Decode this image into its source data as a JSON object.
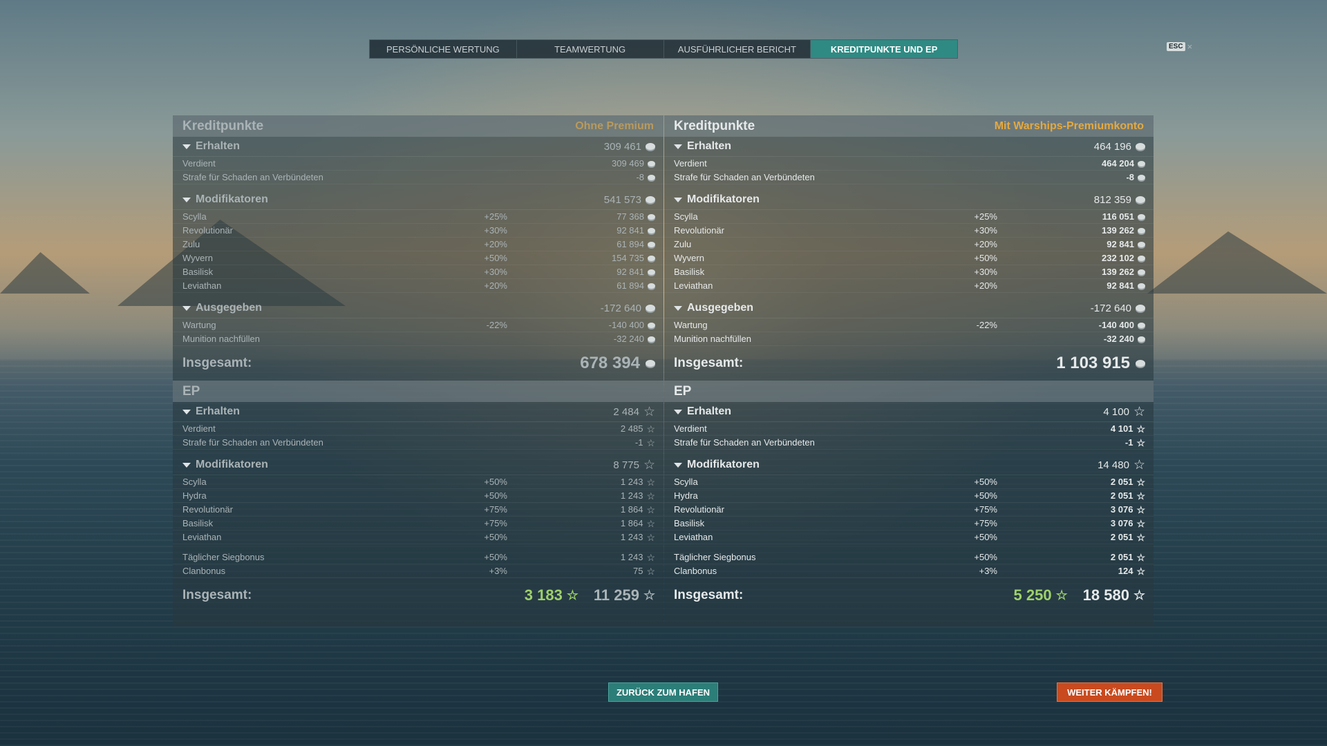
{
  "tabs": [
    {
      "label": "PERSÖNLICHE WERTUNG",
      "active": false
    },
    {
      "label": "TEAMWERTUNG",
      "active": false
    },
    {
      "label": "AUSFÜHRLICHER BERICHT",
      "active": false
    },
    {
      "label": "KREDITPUNKTE UND EP",
      "active": true
    }
  ],
  "esc": {
    "key": "ESC",
    "close": "×"
  },
  "colors": {
    "accent": "#2f8a83",
    "premium": "#e5a93f",
    "fight": "#c94a1e",
    "ep_green": "#9fd16b"
  },
  "icons": {
    "credit": "credit-coin-icon",
    "ep": "star-icon",
    "expand": "triangle-down-icon"
  },
  "left": {
    "credits": {
      "title": "Kreditpunkte",
      "subtitle": "Ohne Premium",
      "earned": {
        "label": "Erhalten",
        "value": "309 461",
        "rows": [
          {
            "name": "Verdient",
            "pct": "",
            "value": "309 469"
          },
          {
            "name": "Strafe für Schaden an Verbündeten",
            "pct": "",
            "value": "-8"
          }
        ]
      },
      "modifiers": {
        "label": "Modifikatoren",
        "value": "541 573",
        "rows": [
          {
            "name": "Scylla",
            "pct": "+25%",
            "value": "77 368"
          },
          {
            "name": "Revolutionär",
            "pct": "+30%",
            "value": "92 841"
          },
          {
            "name": "Zulu",
            "pct": "+20%",
            "value": "61 894"
          },
          {
            "name": "Wyvern",
            "pct": "+50%",
            "value": "154 735"
          },
          {
            "name": "Basilisk",
            "pct": "+30%",
            "value": "92 841"
          },
          {
            "name": "Leviathan",
            "pct": "+20%",
            "value": "61 894"
          }
        ]
      },
      "spent": {
        "label": "Ausgegeben",
        "value": "-172 640",
        "rows": [
          {
            "name": "Wartung",
            "pct": "-22%",
            "value": "-140 400"
          },
          {
            "name": "Munition nachfüllen",
            "pct": "",
            "value": "-32 240"
          }
        ]
      },
      "total": {
        "label": "Insgesamt:",
        "value": "678 394"
      }
    },
    "ep": {
      "title": "EP",
      "earned": {
        "label": "Erhalten",
        "value": "2 484",
        "rows": [
          {
            "name": "Verdient",
            "pct": "",
            "value": "2 485"
          },
          {
            "name": "Strafe für Schaden an Verbündeten",
            "pct": "",
            "value": "-1"
          }
        ]
      },
      "modifiers": {
        "label": "Modifikatoren",
        "value": "8 775",
        "rows": [
          {
            "name": "Scylla",
            "pct": "+50%",
            "value": "1 243"
          },
          {
            "name": "Hydra",
            "pct": "+50%",
            "value": "1 243"
          },
          {
            "name": "Revolutionär",
            "pct": "+75%",
            "value": "1 864"
          },
          {
            "name": "Basilisk",
            "pct": "+75%",
            "value": "1 864"
          },
          {
            "name": "Leviathan",
            "pct": "+50%",
            "value": "1 243"
          }
        ],
        "extra": [
          {
            "name": "Täglicher Siegbonus",
            "pct": "+50%",
            "value": "1 243"
          },
          {
            "name": "Clanbonus",
            "pct": "+3%",
            "value": "75"
          }
        ]
      },
      "total": {
        "label": "Insgesamt:",
        "value_ship": "3 183",
        "value_total": "11 259"
      }
    }
  },
  "right": {
    "credits": {
      "title": "Kreditpunkte",
      "subtitle": "Mit Warships-Premiumkonto",
      "earned": {
        "label": "Erhalten",
        "value": "464 196",
        "rows": [
          {
            "name": "Verdient",
            "pct": "",
            "value": "464 204"
          },
          {
            "name": "Strafe für Schaden an Verbündeten",
            "pct": "",
            "value": "-8"
          }
        ]
      },
      "modifiers": {
        "label": "Modifikatoren",
        "value": "812 359",
        "rows": [
          {
            "name": "Scylla",
            "pct": "+25%",
            "value": "116 051"
          },
          {
            "name": "Revolutionär",
            "pct": "+30%",
            "value": "139 262"
          },
          {
            "name": "Zulu",
            "pct": "+20%",
            "value": "92 841"
          },
          {
            "name": "Wyvern",
            "pct": "+50%",
            "value": "232 102"
          },
          {
            "name": "Basilisk",
            "pct": "+30%",
            "value": "139 262"
          },
          {
            "name": "Leviathan",
            "pct": "+20%",
            "value": "92 841"
          }
        ]
      },
      "spent": {
        "label": "Ausgegeben",
        "value": "-172 640",
        "rows": [
          {
            "name": "Wartung",
            "pct": "-22%",
            "value": "-140 400"
          },
          {
            "name": "Munition nachfüllen",
            "pct": "",
            "value": "-32 240"
          }
        ]
      },
      "total": {
        "label": "Insgesamt:",
        "value": "1 103 915"
      }
    },
    "ep": {
      "title": "EP",
      "earned": {
        "label": "Erhalten",
        "value": "4 100",
        "rows": [
          {
            "name": "Verdient",
            "pct": "",
            "value": "4 101"
          },
          {
            "name": "Strafe für Schaden an Verbündeten",
            "pct": "",
            "value": "-1"
          }
        ]
      },
      "modifiers": {
        "label": "Modifikatoren",
        "value": "14 480",
        "rows": [
          {
            "name": "Scylla",
            "pct": "+50%",
            "value": "2 051"
          },
          {
            "name": "Hydra",
            "pct": "+50%",
            "value": "2 051"
          },
          {
            "name": "Revolutionär",
            "pct": "+75%",
            "value": "3 076"
          },
          {
            "name": "Basilisk",
            "pct": "+75%",
            "value": "3 076"
          },
          {
            "name": "Leviathan",
            "pct": "+50%",
            "value": "2 051"
          }
        ],
        "extra": [
          {
            "name": "Täglicher Siegbonus",
            "pct": "+50%",
            "value": "2 051"
          },
          {
            "name": "Clanbonus",
            "pct": "+3%",
            "value": "124"
          }
        ]
      },
      "total": {
        "label": "Insgesamt:",
        "value_ship": "5 250",
        "value_total": "18 580"
      }
    }
  },
  "buttons": {
    "back": "ZURÜCK ZUM HAFEN",
    "fight": "WEITER KÄMPFEN!"
  }
}
